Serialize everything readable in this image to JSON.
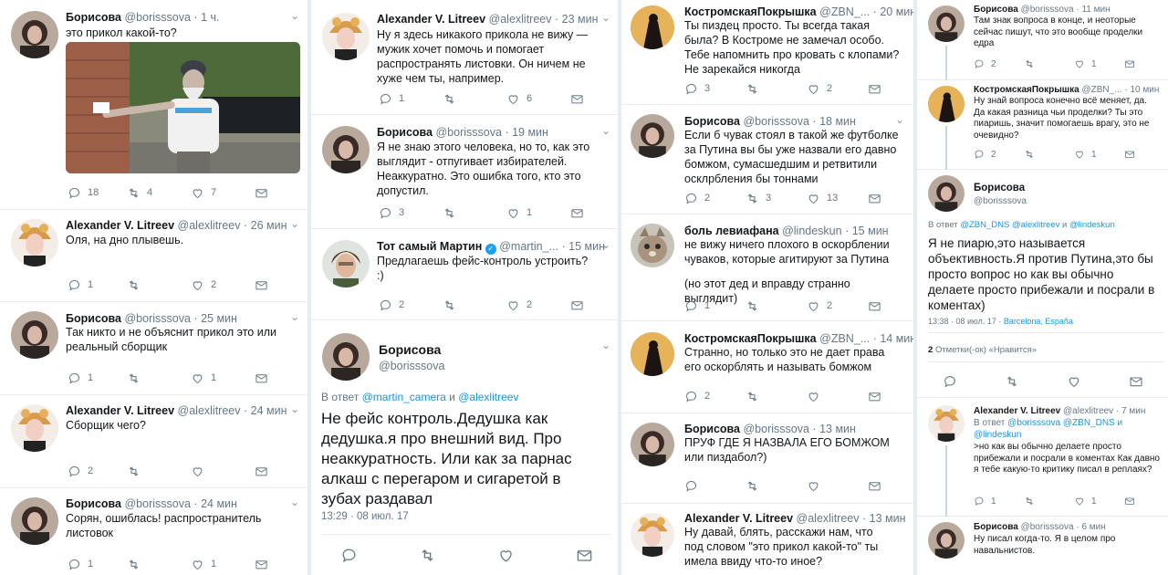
{
  "icons": {
    "reply": "reply-icon",
    "retweet": "retweet-icon",
    "like": "heart-icon",
    "dm": "mail-icon"
  },
  "col1": [
    {
      "name": "Борисова",
      "handle": "@borisssova",
      "time": "1 ч.",
      "text": "это прикол какой-то?",
      "reply": "18",
      "retweet": "4",
      "like": "7"
    },
    {
      "name": "Alexander V. Litreev",
      "handle": "@alexlitreev",
      "time": "26 мин",
      "text": "Оля, на дно плывешь.",
      "reply": "1",
      "retweet": "",
      "like": "2"
    },
    {
      "name": "Борисова",
      "handle": "@borisssova",
      "time": "25 мин",
      "text": "Так никто и не объяснит прикол это или реальный сборщик",
      "reply": "1",
      "retweet": "",
      "like": "1"
    },
    {
      "name": "Alexander V. Litreev",
      "handle": "@alexlitreev",
      "time": "24 мин",
      "text": "Сборщик чего?",
      "reply": "2",
      "retweet": "",
      "like": ""
    },
    {
      "name": "Борисова",
      "handle": "@borisssova",
      "time": "24 мин",
      "text": "Сорян, ошиблась! распространитель листовок",
      "reply": "1",
      "retweet": "",
      "like": "1"
    }
  ],
  "col2": [
    {
      "name": "Alexander V. Litreev",
      "handle": "@alexlitreev",
      "time": "23 мин",
      "text": "Ну я здесь никакого прикола не вижу — мужик хочет помочь и помогает распространять листовки. Он ничем не хуже чем ты, например.",
      "reply": "1",
      "retweet": "",
      "like": "6"
    },
    {
      "name": "Борисова",
      "handle": "@borisssova",
      "time": "19 мин",
      "text": "Я не знаю этого человека, но то, как это выглядит - отпугивает избирателей. Неаккуратно. Это ошибка того, кто это допустил.",
      "reply": "3",
      "retweet": "",
      "like": "1"
    },
    {
      "name": "Тот самый Мартин",
      "handle": "@martin_...",
      "time": "15 мин",
      "text": "Предлагаешь фейс-контроль устроить? :)",
      "reply": "2",
      "retweet": "",
      "like": "2"
    }
  ],
  "focus2": {
    "name": "Борисова",
    "handle": "@borisssova",
    "reply_prefix": "В ответ",
    "reply_a": "@martin_camera",
    "reply_and": "и",
    "reply_b": "@alexlitreev",
    "text": "Не фейс контроль.Дедушка как дедушка.я про внешний вид. Про неаккуратность. Или как за парнас алкаш с перегаром и сигаретой в зубах раздавал",
    "meta": "13:29 · 08 июл. 17"
  },
  "col3": [
    {
      "name": "КостромскаяПокрышка",
      "handle": "@ZBN_...",
      "time": "20 мин",
      "text": "Ты пиздец просто. Ты всегда такая была? В Костроме не замечал особо. Тебе напомнить про кровать с клопами? Не зарекайся никогда",
      "reply": "3",
      "retweet": "",
      "like": "2"
    },
    {
      "name": "Борисова",
      "handle": "@borisssova",
      "time": "18 мин",
      "text": "Если б чувак стоял в такой же футболке за Путина вы бы уже назвали его давно бомжом, сумасшедшим и ретвитили осклрбления бы тоннами",
      "reply": "2",
      "retweet": "3",
      "like": "13"
    },
    {
      "name": "боль левиафана",
      "handle": "@lindeskun",
      "time": "15 мин",
      "text": "не вижу ничего плохого в оскорблении чуваков, которые агитируют за Путина",
      "text2": "(но этот дед и вправду странно выглядит)",
      "reply": "1",
      "retweet": "",
      "like": "2"
    },
    {
      "name": "КостромскаяПокрышка",
      "handle": "@ZBN_...",
      "time": "14 мин",
      "text": "Странно, но только это не дает права его оскорблять и называть бомжом",
      "reply": "2",
      "retweet": "",
      "like": ""
    },
    {
      "name": "Борисова",
      "handle": "@borisssova",
      "time": "13 мин",
      "text": "ПРУФ ГДЕ Я НАЗВАЛА ЕГО БОМЖОМ или пиздабол?)",
      "reply": "",
      "retweet": "",
      "like": ""
    },
    {
      "name": "Alexander V. Litreev",
      "handle": "@alexlitreev",
      "time": "13 мин",
      "text": "Ну давай, блять, расскажи нам, что под словом \"это прикол какой-то\" ты имела ввиду что-то иное?",
      "reply": "",
      "retweet": "",
      "like": ""
    }
  ],
  "col4": [
    {
      "name": "Борисова",
      "handle": "@borisssova",
      "time": "11 мин",
      "text": "Там знак вопроса в конце, и неоторые сейчас пишут, что это вообще проделки едра",
      "reply": "2",
      "retweet": "",
      "like": "1"
    },
    {
      "name": "КостромскаяПокрышка",
      "handle": "@ZBN_...",
      "time": "10 мин",
      "text": "Ну знай вопроса конечно всё меняет, да. Да какая разница чьи проделки? Ты это пиаришь, значит помогаешь врагу, это не очевидно?",
      "reply": "2",
      "retweet": "",
      "like": "1"
    }
  ],
  "focus4": {
    "name": "Борисова",
    "handle": "@borisssova",
    "reply_prefix": "В ответ",
    "reply_a": "@ZBN_DNS",
    "reply_b": "@alexlitreev",
    "reply_and": "и",
    "reply_c": "@lindeskun",
    "text": "Я не пиарю,это называется объективность.Я против Путина,это бы просто вопрос но как вы обычно делаете просто прибежали и посрали в коментах)",
    "meta": "13:38 · 08 июл. 17 ·",
    "meta_place": "Barcelona, España",
    "likes_count": "2",
    "likes_label": "Отметки(-ок) «Нравится»"
  },
  "col4b": [
    {
      "name": "Alexander V. Litreev",
      "handle": "@alexlitreev",
      "time": "7 мин",
      "reply_prefix": "В ответ",
      "reply_to": "@borisssova @ZBN_DNS и @lindeskun",
      "text": ">но как вы обычно делаете просто прибежали и посрали в коментах Как давно я тебе какую-то критику писал в реплаях?",
      "reply": "1",
      "retweet": "",
      "like": "1"
    },
    {
      "name": "Борисова",
      "handle": "@borisssova",
      "time": "6 мин",
      "text": "Ну писал когда-то. Я в целом про навальнистов.",
      "reply": "",
      "retweet": "",
      "like": ""
    }
  ],
  "dot": "·",
  "chev": "⌄"
}
